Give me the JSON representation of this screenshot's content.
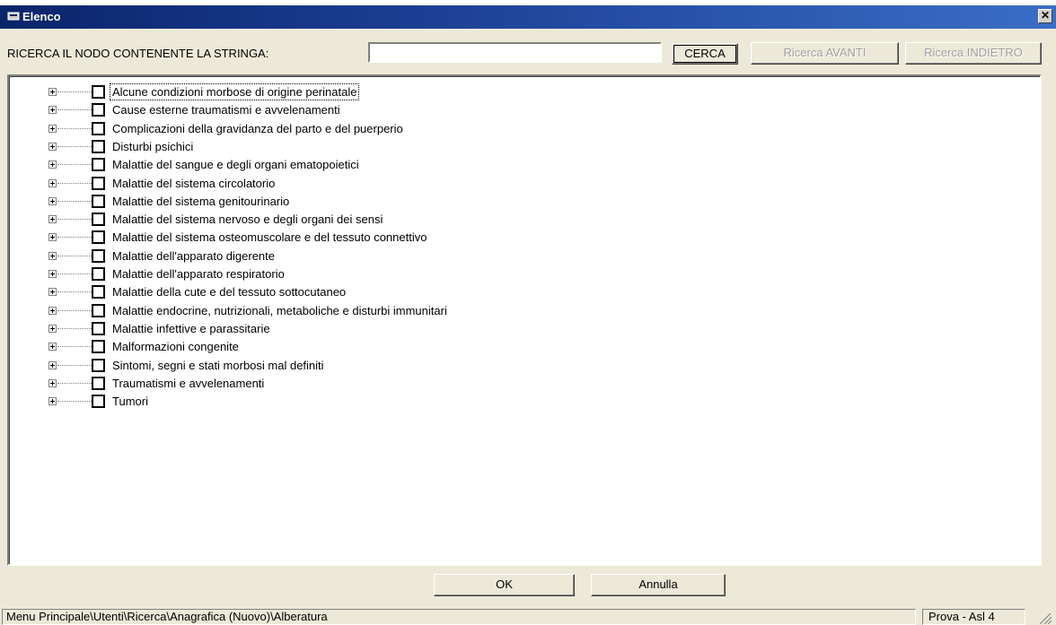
{
  "window": {
    "title": "Elenco",
    "close_symbol": "✕"
  },
  "search": {
    "label": "RICERCA IL NODO CONTENENTE LA STRINGA:",
    "value": "",
    "placeholder": ""
  },
  "buttons": {
    "search": "CERCA",
    "next": "Ricerca AVANTI",
    "prev": "Ricerca INDIETRO",
    "ok": "OK",
    "cancel": "Annulla"
  },
  "tree": {
    "items": [
      "Alcune condizioni morbose di origine perinatale",
      "Cause esterne traumatismi e avvelenamenti",
      "Complicazioni della gravidanza del parto e del puerperio",
      "Disturbi psichici",
      "Malattie del sangue e degli organi ematopoietici",
      "Malattie del sistema circolatorio",
      "Malattie del sistema genitourinario",
      "Malattie del sistema nervoso e degli organi dei sensi",
      "Malattie del sistema osteomuscolare e del tessuto connettivo",
      "Malattie dell'apparato digerente",
      "Malattie dell'apparato respiratorio",
      "Malattie della cute e del tessuto sottocutaneo",
      "Malattie endocrine, nutrizionali, metaboliche e disturbi immunitari",
      "Malattie infettive e parassitarie",
      "Malformazioni congenite",
      "Sintomi, segni e stati morbosi mal definiti",
      "Traumatismi e avvelenamenti",
      "Tumori"
    ]
  },
  "status": {
    "path": "Menu Principale\\Utenti\\Ricerca\\Anagrafica (Nuovo)\\Alberatura",
    "right": "Prova - Asl 4"
  }
}
